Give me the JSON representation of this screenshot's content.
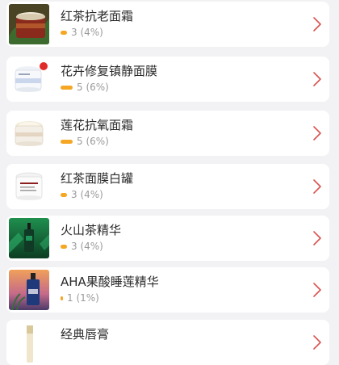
{
  "accent_color": "#f5a623",
  "chevron_color": "#d9534f",
  "products": [
    {
      "name": "红茶抗老面霜",
      "count_text": "3 (4%)",
      "share": 0.04,
      "image": "black-tea-cream-jar-thumbnail"
    },
    {
      "name": "花卉修复镇静面膜",
      "count_text": "5 (6%)",
      "share": 0.06,
      "image": "floral-calming-mask-jar-thumbnail"
    },
    {
      "name": "莲花抗氧面霜",
      "count_text": "5 (6%)",
      "share": 0.06,
      "image": "lotus-cream-open-jar-thumbnail"
    },
    {
      "name": "红茶面膜白罐",
      "count_text": "3 (4%)",
      "share": 0.04,
      "image": "black-tea-mask-white-jar-thumbnail"
    },
    {
      "name": "火山茶精华",
      "count_text": "3 (4%)",
      "share": 0.04,
      "image": "volcanic-tea-serum-bottle-thumbnail"
    },
    {
      "name": "AHA果酸睡莲精华",
      "count_text": "1 (1%)",
      "share": 0.01,
      "image": "aha-water-lily-serum-bottle-thumbnail"
    },
    {
      "name": "经典唇膏",
      "count_text": "",
      "share": null,
      "image": "classic-lip-balm-tube-thumbnail"
    }
  ]
}
